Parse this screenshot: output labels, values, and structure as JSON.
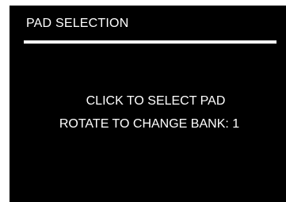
{
  "header": {
    "title": "PAD SELECTION"
  },
  "instructions": {
    "select_pad": "CLICK TO SELECT PAD",
    "change_bank_prefix": "ROTATE TO CHANGE BANK: ",
    "bank_number": "1"
  },
  "colors": {
    "background": "#000000",
    "text": "#ffffff",
    "page": "#ffffff"
  }
}
